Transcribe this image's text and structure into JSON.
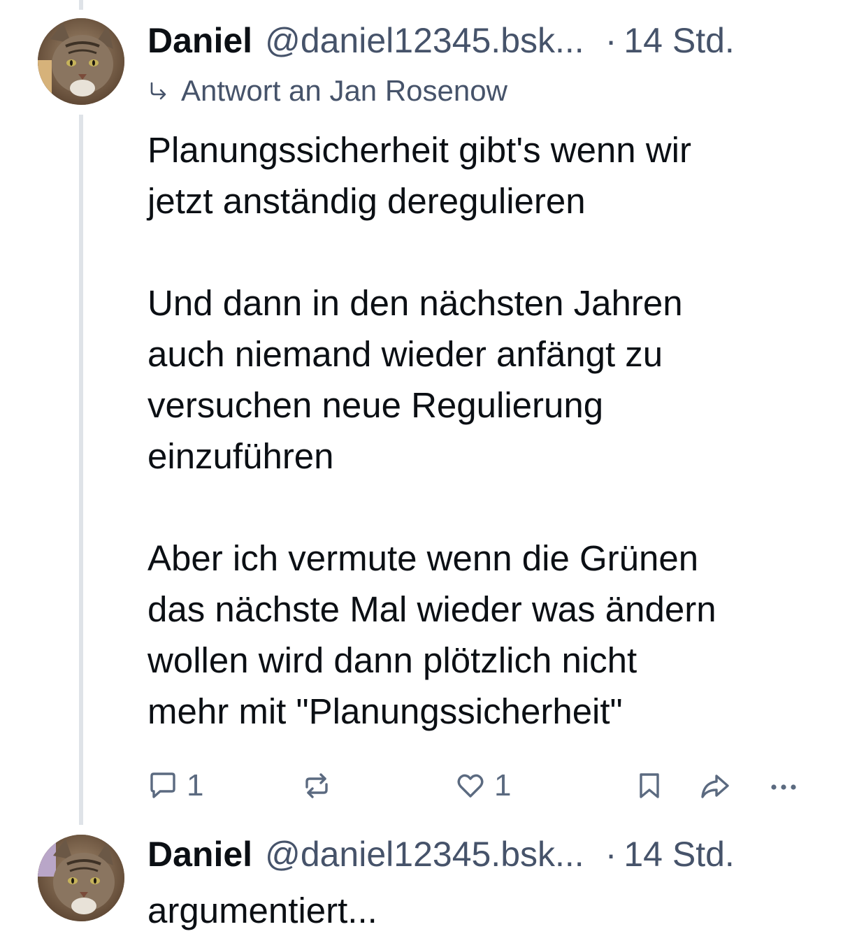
{
  "posts": [
    {
      "author_name": "Daniel",
      "handle": "@daniel12345.bsk...",
      "dot": "·",
      "time": "14 Std.",
      "reply_to": "Antwort an Jan Rosenow",
      "text": "Planungssicherheit gibt's wenn wir\njetzt anständig deregulieren\n\nUnd dann in den nächsten Jahren\nauch niemand wieder anfängt zu\nversuchen neue Regulierung\neinzuführen\n\nAber ich vermute wenn die Grünen\ndas nächste Mal wieder was ändern\nwollen wird dann plötzlich nicht\nmehr mit \"Planungssicherheit\"",
      "actions": {
        "reply_count": "1",
        "like_count": "1"
      }
    },
    {
      "author_name": "Daniel",
      "handle": "@daniel12345.bsk...",
      "dot": "·",
      "time": "14 Std.",
      "text": "argumentiert..."
    }
  ],
  "icons": {
    "reply": "comment-icon",
    "repost": "repost-icon",
    "like": "heart-icon",
    "bookmark": "bookmark-icon",
    "share": "share-icon",
    "more": "more-icon"
  },
  "colors": {
    "text": "#0b0f14",
    "muted": "#46536a",
    "icon": "#5b6a80",
    "thread_line": "#dfe3e8"
  }
}
